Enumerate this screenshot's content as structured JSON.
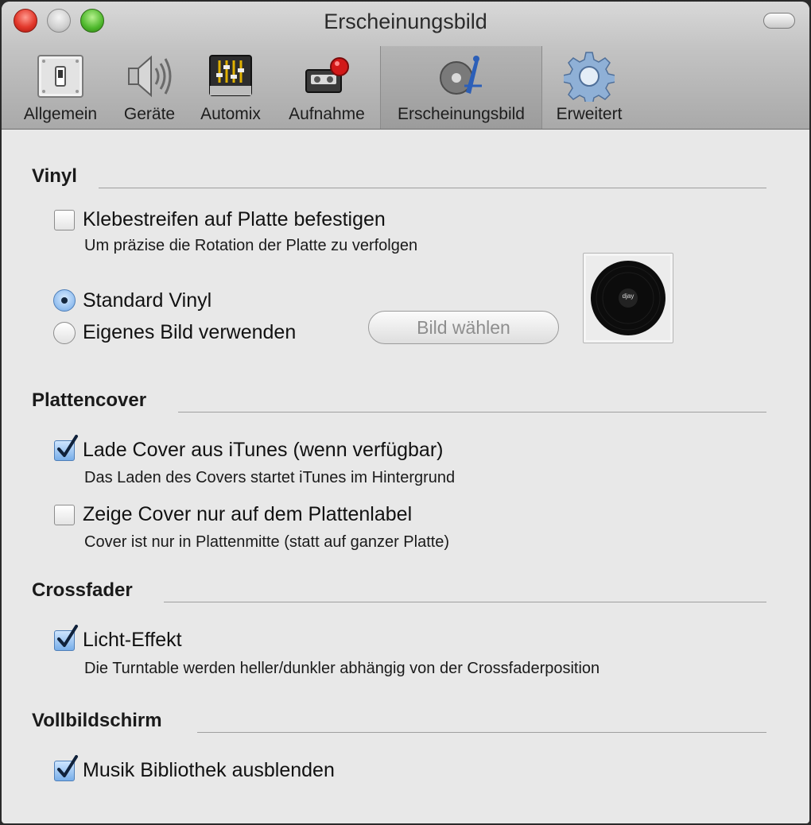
{
  "window": {
    "title": "Erscheinungsbild"
  },
  "toolbar": {
    "items": [
      {
        "label": "Allgemein",
        "icon": "switch-icon"
      },
      {
        "label": "Geräte",
        "icon": "speaker-icon"
      },
      {
        "label": "Automix",
        "icon": "mixer-icon"
      },
      {
        "label": "Aufnahme",
        "icon": "record-icon"
      },
      {
        "label": "Erscheinungsbild",
        "icon": "appearance-icon",
        "selected": true
      },
      {
        "label": "Erweitert",
        "icon": "gear-icon"
      }
    ]
  },
  "vinyl": {
    "title": "Vinyl",
    "tape_label": "Klebestreifen auf Platte befestigen",
    "tape_checked": false,
    "tape_desc": "Um präzise die Rotation der Platte zu verfolgen",
    "standard_label": "Standard Vinyl",
    "custom_label": "Eigenes Bild verwenden",
    "selected": "standard",
    "choose_button": "Bild wählen",
    "preview_label": "djay"
  },
  "cover": {
    "title": "Plattencover",
    "itunes_label": "Lade Cover aus iTunes (wenn verfügbar)",
    "itunes_checked": true,
    "itunes_desc": "Das Laden des Covers startet iTunes im Hintergrund",
    "label_only_label": "Zeige Cover nur auf dem Plattenlabel",
    "label_only_checked": false,
    "label_only_desc": "Cover ist nur in Plattenmitte (statt auf ganzer Platte)"
  },
  "crossfader": {
    "title": "Crossfader",
    "light_label": "Licht-Effekt",
    "light_checked": true,
    "light_desc": "Die Turntable werden heller/dunkler abhängig von der Crossfaderposition"
  },
  "fullscreen": {
    "title": "Vollbildschirm",
    "hide_library_label": "Musik Bibliothek ausblenden",
    "hide_library_checked": true
  },
  "colors": {
    "accent": "#4f7fb8",
    "check": "#10223b"
  }
}
